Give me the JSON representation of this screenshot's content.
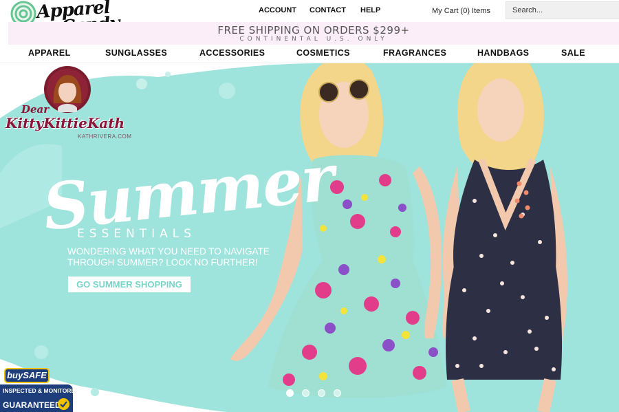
{
  "header": {
    "logo_lines": [
      "Apparel",
      "Candy"
    ],
    "top_links": [
      "ACCOUNT",
      "CONTACT",
      "HELP"
    ],
    "cart_label": "My Cart (0) Items",
    "search_placeholder": "Search..."
  },
  "shipping_banner": {
    "main": "FREE SHIPPING ON ORDERS $299+",
    "sub": "CONTINENTAL U.S. ONLY"
  },
  "category_nav": [
    "APPAREL",
    "SUNGLASSES",
    "ACCESSORIES",
    "COSMETICS",
    "FRAGRANCES",
    "HANDBAGS",
    "SALE"
  ],
  "hero": {
    "script_title": "Summer",
    "subtitle": "ESSENTIALS",
    "text_line1": "WONDERING WHAT YOU NEED TO NAVIGATE",
    "text_line2": "THROUGH SUMMER? LOOK NO FURTHER!",
    "cta_label": "GO SUMMER SHOPPING",
    "slide_count": 4,
    "active_slide": 1
  },
  "watermark": {
    "line1": "Dear",
    "line2": "KittyKittieKath",
    "line3": "KATHRIVERA.COM"
  },
  "badge": {
    "logo": "buySAFE",
    "line1": "INSPECTED & MONITORED",
    "line2": "GUARANTEED"
  },
  "colors": {
    "hero_mint": "#9ee3dc",
    "banner_pink": "#fbeef8",
    "watermark_burgundy": "#8a1538",
    "badge_navy": "#1d3e7b",
    "badge_gold": "#f2c200"
  },
  "icons": [
    "lollipop-icon",
    "check-icon"
  ]
}
